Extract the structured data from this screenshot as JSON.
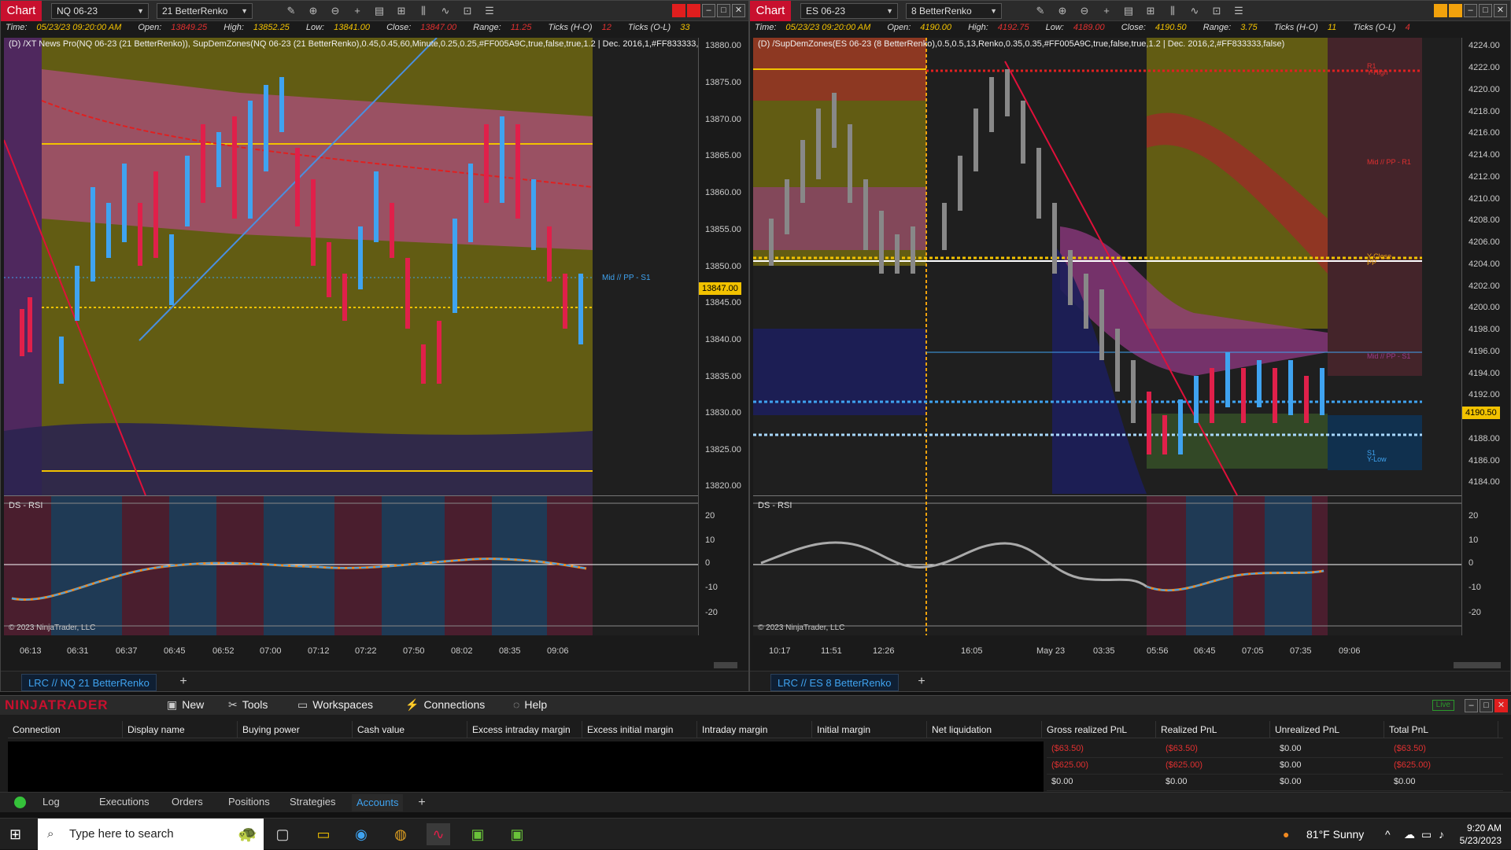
{
  "left": {
    "chart_label": "Chart",
    "instrument": "NQ 06-23",
    "bar_type": "21 BetterRenko",
    "info": {
      "time_label": "Time:",
      "time": "05/23/23 09:20:00 AM",
      "open_label": "Open:",
      "open": "13849.25",
      "high_label": "High:",
      "high": "13852.25",
      "low_label": "Low:",
      "low": "13841.00",
      "close_label": "Close:",
      "close": "13847.00",
      "range_label": "Range:",
      "range": "11.25",
      "ticks_ho_label": "Ticks (H-O)",
      "ticks_ho": "12",
      "ticks_ol_label": "Ticks (O-L)",
      "ticks_ol": "33"
    },
    "indicator_desc": "(D) /XT News Pro(NQ 06-23 (21 BetterRenko)), SupDemZones(NQ 06-23 (21 BetterRenko),0.45,0.45,60,Minute,0.25,0.25,#FF005A9C,true,false,true,1.2 | Dec. 2016,1,#FF833333,true)",
    "zone_label": "Mid // PP - S1",
    "price_ticks": [
      "13880.00",
      "13875.00",
      "13870.00",
      "13865.00",
      "13860.00",
      "13855.00",
      "13850.00",
      "13845.00",
      "13840.00",
      "13835.00",
      "13830.00",
      "13825.00",
      "13820.00"
    ],
    "last_price": "13847.00",
    "osc_label": "DS - RSI",
    "osc_ticks": [
      "20",
      "10",
      "0",
      "-10",
      "-20"
    ],
    "copyright": "© 2023 NinjaTrader, LLC",
    "time_ticks": [
      "06:13",
      "06:31",
      "06:37",
      "06:45",
      "06:52",
      "07:00",
      "07:12",
      "07:22",
      "07:50",
      "08:02",
      "08:35",
      "09:06"
    ],
    "tab_label": "LRC // NQ  21 BetterRenko"
  },
  "right": {
    "chart_label": "Chart",
    "instrument": "ES 06-23",
    "bar_type": "8 BetterRenko",
    "info": {
      "time_label": "Time:",
      "time": "05/23/23 09:20:00 AM",
      "open_label": "Open:",
      "open": "4190.00",
      "high_label": "High:",
      "high": "4192.75",
      "low_label": "Low:",
      "low": "4189.00",
      "close_label": "Close:",
      "close": "4190.50",
      "range_label": "Range:",
      "range": "3.75",
      "ticks_ho_label": "Ticks (H-O)",
      "ticks_ho": "11",
      "ticks_ol_label": "Ticks (O-L)",
      "ticks_ol": "4"
    },
    "indicator_desc": "(D) /SupDemZones(ES 06-23 (8 BetterRenko),0.5,0.5,13,Renko,0.35,0.35,#FF005A9C,true,false,true,1.2 | Dec. 2016,2,#FF833333,false)",
    "zone_labels": {
      "r1": "R1",
      "yhigh": "Y-High",
      "mid_r1": "Mid // PP - R1",
      "yclose": "Y-Close",
      "pp": "PP",
      "mid_s1": "Mid // PP - S1",
      "s1": "S1",
      "ylow": "Y-Low"
    },
    "price_ticks": [
      "4224.00",
      "4222.00",
      "4220.00",
      "4218.00",
      "4216.00",
      "4214.00",
      "4212.00",
      "4210.00",
      "4208.00",
      "4206.00",
      "4204.00",
      "4202.00",
      "4200.00",
      "4198.00",
      "4196.00",
      "4194.00",
      "4192.00",
      "4190.00",
      "4188.00",
      "4186.00",
      "4184.00"
    ],
    "last_price": "4190.50",
    "osc_label": "DS - RSI",
    "osc_ticks": [
      "20",
      "10",
      "0",
      "-10",
      "-20"
    ],
    "copyright": "© 2023 NinjaTrader, LLC",
    "time_ticks": [
      "10:17",
      "11:51",
      "12:26",
      "16:05",
      "May 23",
      "03:35",
      "05:56",
      "06:45",
      "07:05",
      "07:35",
      "09:06"
    ],
    "tab_label": "LRC // ES  8 BetterRenko"
  },
  "control_center": {
    "logo": "NINJATRADER",
    "menu": [
      "New",
      "Tools",
      "Workspaces",
      "Connections",
      "Help"
    ],
    "live": "Live",
    "columns": [
      "Connection",
      "Display name",
      "Buying power",
      "Cash value",
      "Excess intraday margin",
      "Excess initial margin",
      "Intraday margin",
      "Initial margin",
      "Net liquidation",
      "Gross realized PnL",
      "Realized PnL",
      "Unrealized PnL",
      "Total PnL"
    ],
    "rows": [
      [
        "($63.50)",
        "($63.50)",
        "$0.00",
        "($63.50)"
      ],
      [
        "($625.00)",
        "($625.00)",
        "$0.00",
        "($625.00)"
      ],
      [
        "$0.00",
        "$0.00",
        "$0.00",
        "$0.00"
      ]
    ],
    "tabs": [
      "Log",
      "Executions",
      "Orders",
      "Positions",
      "Strategies",
      "Accounts"
    ],
    "active_tab": "Accounts"
  },
  "taskbar": {
    "search_placeholder": "Type here to search",
    "weather": "81°F  Sunny",
    "time": "9:20 AM",
    "date": "5/23/2023"
  },
  "colors": {
    "accent_red": "#c8102e",
    "price_tag": "#f2c200",
    "tab_blue": "#3fa3f0",
    "live_green": "#2b9a2b"
  }
}
